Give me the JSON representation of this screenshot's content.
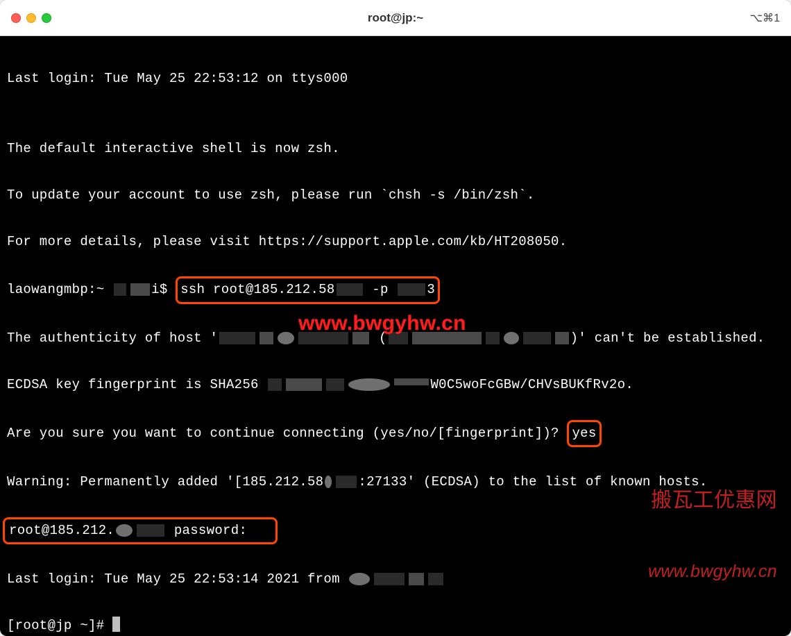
{
  "window": {
    "title": "root@jp:~",
    "shortcut": "⌥⌘1"
  },
  "terminal": {
    "line1": "Last login: Tue May 25 22:53:12 on ttys000",
    "line2": "",
    "line3": "The default interactive shell is now zsh.",
    "line4": "To update your account to use zsh, please run `chsh -s /bin/zsh`.",
    "line5": "For more details, please visit https://support.apple.com/kb/HT208050.",
    "prompt_local": "laowangmbp:~ ",
    "prompt_suffix": "i$ ",
    "ssh_cmd_a": "ssh root@185.212.58",
    "ssh_cmd_b": " -p ",
    "ssh_cmd_c": "3",
    "auth_a": "The authenticity of host '",
    "auth_b": "(",
    "auth_c": ")' can't be established.",
    "ecdsa_a": "ECDSA key fingerprint is SHA256",
    "ecdsa_b": "W0C5woFcGBw/CHVsBUKfRv2o.",
    "confirm_prompt": "Are you sure you want to continue connecting (yes/no/[fingerprint])? ",
    "confirm_answer": "yes",
    "warn_a": "Warning: Permanently added '[185.212.58",
    "warn_b": ":27133' (ECDSA) to the list of known hosts.",
    "pass_a": "root@185.212.",
    "pass_b": " password:",
    "last_login2": "Last login: Tue May 25 22:53:14 2021 from ",
    "prompt_remote": "[root@jp ~]# "
  },
  "watermark": {
    "center": "www.bwgyhw.cn",
    "bottom_cn": "搬瓦工优惠网",
    "bottom_url": "www.bwgyhw.cn"
  }
}
